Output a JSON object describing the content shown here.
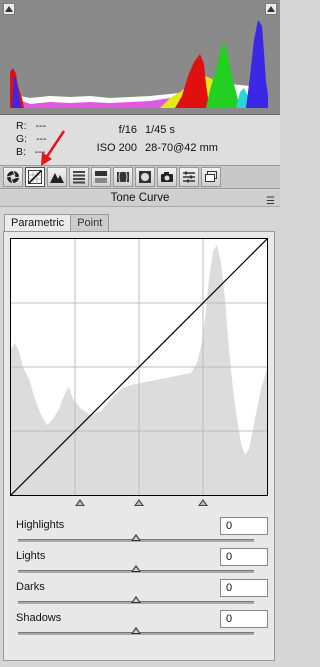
{
  "histogram": {
    "colors": {
      "red": "#e01010",
      "green": "#22d022",
      "blue": "#3a28e6",
      "yellow": "#e6e618",
      "cyan": "#28d8d8",
      "magenta": "#e020e0",
      "white": "#ffffff"
    }
  },
  "readout": {
    "r_label": "R:",
    "r_value": "---",
    "g_label": "G:",
    "g_value": "---",
    "b_label": "B:",
    "b_value": "---"
  },
  "camera": {
    "aperture": "f/16",
    "shutter": "1/45 s",
    "iso": "ISO 200",
    "lens": "28-70@42 mm"
  },
  "tools": [
    {
      "name": "basic",
      "icon": "aperture-icon"
    },
    {
      "name": "tone-curve",
      "icon": "curve-icon",
      "active": true
    },
    {
      "name": "detail",
      "icon": "detail-icon"
    },
    {
      "name": "hsl",
      "icon": "hsl-icon"
    },
    {
      "name": "split-toning",
      "icon": "split-toning-icon"
    },
    {
      "name": "lens-corrections",
      "icon": "lens-icon"
    },
    {
      "name": "effects",
      "icon": "effects-icon"
    },
    {
      "name": "camera-calibration",
      "icon": "camera-icon"
    },
    {
      "name": "presets",
      "icon": "presets-icon"
    },
    {
      "name": "snapshots",
      "icon": "snapshots-icon"
    }
  ],
  "panel": {
    "title": "Tone Curve",
    "tabs": [
      "Parametric",
      "Point"
    ]
  },
  "sliders": [
    {
      "label": "Highlights",
      "value": "0",
      "position": 0.5
    },
    {
      "label": "Lights",
      "value": "0",
      "position": 0.5
    },
    {
      "label": "Darks",
      "value": "0",
      "position": 0.5
    },
    {
      "label": "Shadows",
      "value": "0",
      "position": 0.5
    }
  ],
  "annotation": {
    "color": "#e8141c"
  }
}
